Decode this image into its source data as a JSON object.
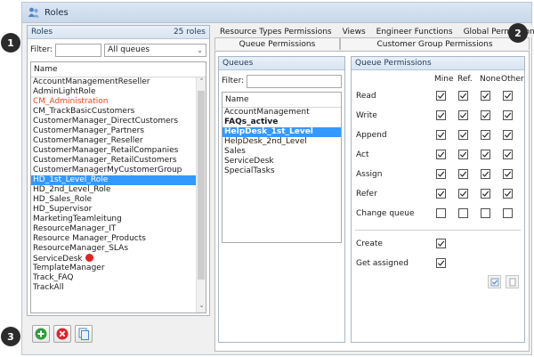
{
  "window": {
    "title": "Roles"
  },
  "badges": [
    "1",
    "2",
    "3"
  ],
  "roles_panel": {
    "header": "Roles",
    "count": "25 roles",
    "filter_label": "Filter:",
    "filter_value": "",
    "queue_select": "All queues",
    "column_name": "Name",
    "items": [
      {
        "label": "AccountManagementReseller"
      },
      {
        "label": "AdminLightRole"
      },
      {
        "label": "CM_Administration",
        "red": true
      },
      {
        "label": "CM_TrackBasicCustomers"
      },
      {
        "label": "CustomerManager_DirectCustomers"
      },
      {
        "label": "CustomerManager_Partners"
      },
      {
        "label": "CustomerManager_Reseller"
      },
      {
        "label": "CustomerManager_RetailCompanies"
      },
      {
        "label": "CustomerManager_RetailCustomers"
      },
      {
        "label": "CustomerManagerMyCustomerGroup"
      },
      {
        "label": "HD_1st_Level_Role",
        "selected": true
      },
      {
        "label": "HD_2nd_Level_Role"
      },
      {
        "label": "HD_Sales_Role"
      },
      {
        "label": "HD_Supervisor"
      },
      {
        "label": "MarketingTeamleitung"
      },
      {
        "label": "ResourceManager_IT"
      },
      {
        "label": "Resource Manager_Products"
      },
      {
        "label": "ResourceManager_SLAs"
      },
      {
        "label": "ServiceDesk",
        "dot": true
      },
      {
        "label": "TemplateManager"
      },
      {
        "label": "Track_FAQ"
      },
      {
        "label": "TrackAll"
      }
    ]
  },
  "toolbar": {
    "add_icon": "add-icon",
    "delete_icon": "delete-icon",
    "copy_icon": "copy-icon"
  },
  "tabs": {
    "row1": [
      "Resource Types Permissions",
      "Views",
      "Engineer Functions",
      "Global Permissions"
    ],
    "row2": [
      "Queue Permissions",
      "Customer Group Permissions"
    ],
    "active": "Queue Permissions"
  },
  "queues_panel": {
    "header": "Queues",
    "filter_label": "Filter:",
    "column_name": "Name",
    "items": [
      {
        "label": "AccountManagement"
      },
      {
        "label": "FAQs_active",
        "bold": true
      },
      {
        "label": "HelpDesk_1st_Level",
        "selected": true
      },
      {
        "label": "HelpDesk_2nd_Level"
      },
      {
        "label": "Sales"
      },
      {
        "label": "ServiceDesk"
      },
      {
        "label": "SpecialTasks"
      }
    ]
  },
  "permissions_panel": {
    "header": "Queue Permissions",
    "columns": [
      "Mine",
      "Ref.",
      "None",
      "Other"
    ],
    "rows": [
      {
        "label": "Read",
        "checks": [
          true,
          true,
          true,
          true
        ]
      },
      {
        "label": "Write",
        "checks": [
          true,
          true,
          true,
          true
        ]
      },
      {
        "label": "Append",
        "checks": [
          true,
          true,
          true,
          true
        ]
      },
      {
        "label": "Act",
        "checks": [
          true,
          true,
          true,
          true
        ]
      },
      {
        "label": "Assign",
        "checks": [
          true,
          true,
          true,
          true
        ]
      },
      {
        "label": "Refer",
        "checks": [
          true,
          true,
          true,
          true
        ]
      },
      {
        "label": "Change queue",
        "checks": [
          false,
          false,
          false,
          false
        ]
      }
    ],
    "extra_rows": [
      {
        "label": "Create",
        "checked": true
      },
      {
        "label": "Get assigned",
        "checked": true
      }
    ]
  }
}
